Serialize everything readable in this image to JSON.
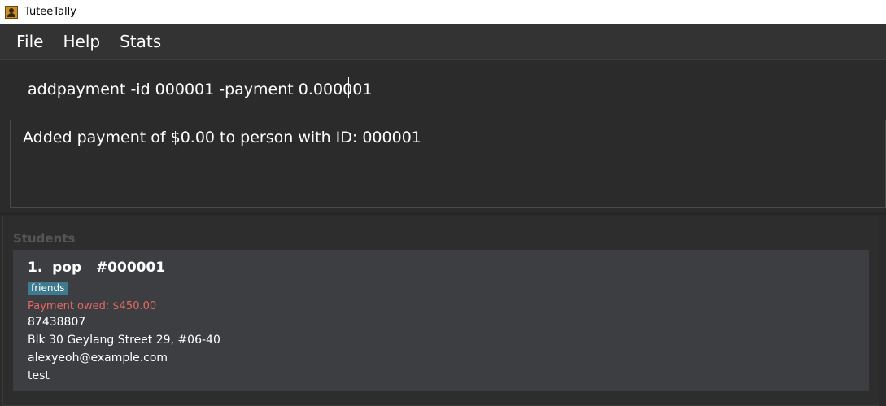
{
  "window": {
    "title": "TuteeTally",
    "icon": "app-icon"
  },
  "menu": {
    "items": [
      "File",
      "Help",
      "Stats"
    ]
  },
  "command": {
    "value": "addpayment -id 000001 -payment 0.000001"
  },
  "result": {
    "message": "Added payment of $0.00 to person with ID: 000001"
  },
  "students": {
    "heading": "Students",
    "list": [
      {
        "index": "1.",
        "name": "pop",
        "id": "#000001",
        "tag": "friends",
        "payment_owed": "Payment owed: $450.00",
        "phone": "87438807",
        "address": "Blk 30 Geylang Street 29, #06-40",
        "email": "alexyeoh@example.com",
        "remark": "test"
      }
    ]
  },
  "colors": {
    "background": "#2b2b2b",
    "card": "#3c3e42",
    "tag": "#3e7b91",
    "payment_owed": "#e8695e"
  }
}
